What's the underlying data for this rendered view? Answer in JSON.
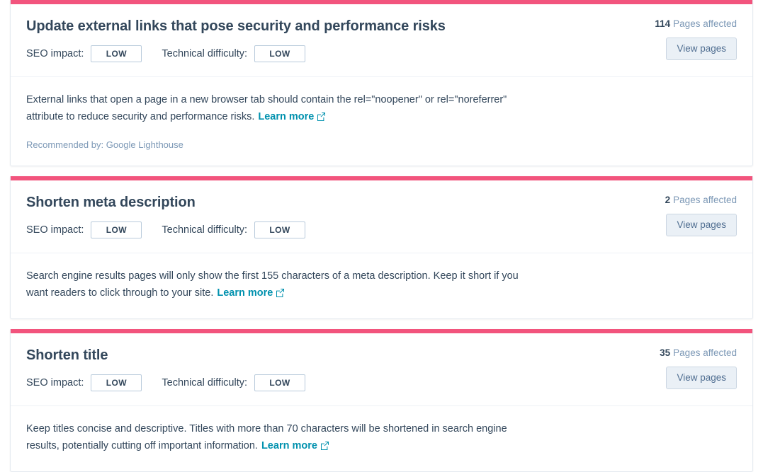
{
  "theme": {
    "accent_bar_color": "#f2547d",
    "title_color": "#33475b",
    "link_color": "#0091ae",
    "muted_color": "#7c98b6",
    "button_bg": "#eaf0f6",
    "button_border": "#cbd6e2"
  },
  "labels": {
    "seo_impact": "SEO impact:",
    "technical_difficulty": "Technical difficulty:",
    "pages_affected_suffix": "Pages affected",
    "view_pages": "View pages",
    "learn_more": "Learn more",
    "external_link_icon": "external-link-icon"
  },
  "cards": [
    {
      "title": "Update external links that pose security and performance risks",
      "seo_impact": "LOW",
      "technical_difficulty": "LOW",
      "pages_affected_count": "114",
      "description": "External links that open a page in a new browser tab should contain the rel=\"noopener\" or rel=\"noreferrer\" attribute to reduce security and performance risks.",
      "recommended_by": "Recommended by: Google Lighthouse"
    },
    {
      "title": "Shorten meta description",
      "seo_impact": "LOW",
      "technical_difficulty": "LOW",
      "pages_affected_count": "2",
      "description": "Search engine results pages will only show the first 155 characters of a meta description. Keep it short if you want readers to click through to your site.",
      "recommended_by": ""
    },
    {
      "title": "Shorten title",
      "seo_impact": "LOW",
      "technical_difficulty": "LOW",
      "pages_affected_count": "35",
      "description": "Keep titles concise and descriptive. Titles with more than 70 characters will be shortened in search engine results, potentially cutting off important information.",
      "recommended_by": ""
    }
  ]
}
